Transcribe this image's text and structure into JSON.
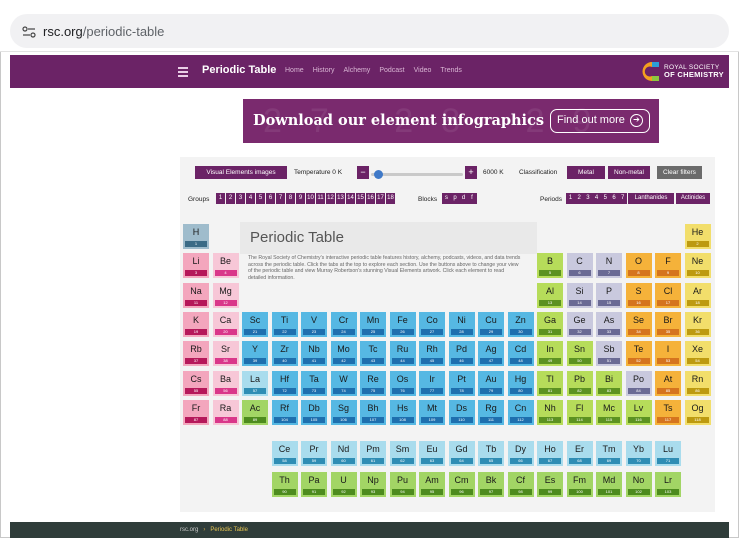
{
  "browser": {
    "url_domain": "rsc.org",
    "url_path": "/periodic-table"
  },
  "nav": {
    "title": "Periodic Table",
    "links": [
      "Home",
      "History",
      "Alchemy",
      "Podcast",
      "Video",
      "Trends"
    ],
    "logo_line1": "ROYAL SOCIETY",
    "logo_line2": "OF CHEMISTRY"
  },
  "banner": {
    "text": "Download our element infographics",
    "button": "Find out more",
    "bg_numbers": "27 28 29 30"
  },
  "controls": {
    "visual": "Visual Elements images",
    "temperature_label": "Temperature 0 K",
    "temp_value": "6000 K",
    "classification_label": "Classification",
    "metal": "Metal",
    "nonmetal": "Non-metal",
    "clear": "Clear filters",
    "groups_label": "Groups",
    "groups": [
      "1",
      "2",
      "3",
      "4",
      "5",
      "6",
      "7",
      "8",
      "9",
      "10",
      "11",
      "12",
      "13",
      "14",
      "15",
      "16",
      "17",
      "18"
    ],
    "blocks_label": "Blocks",
    "blocks": [
      "s",
      "p",
      "d",
      "f"
    ],
    "periods_label": "Periods",
    "periods": [
      "1",
      "2",
      "3",
      "4",
      "5",
      "6",
      "7"
    ],
    "lanthanides": "Lanthanides",
    "actinides": "Actinides"
  },
  "title": "Periodic Table",
  "description": "The Royal Society of Chemistry's interactive periodic table features history, alchemy, podcasts, videos, and data trends across the periodic table. Click the tabs at the top to explore each section. Use the buttons above to change your view of the periodic table and view Murray Robertson's stunning Visual Elements artwork. Click each element to read detailed information.",
  "colors": {
    "purple": "#6b2366",
    "alkali": "#f3a6bd",
    "alkali_num": "#b5185a",
    "alkaline": "#f7c7d7",
    "alkaline_num": "#d9378a",
    "transition": "#56b8e3",
    "transition_num": "#1e6fae",
    "post": "#b6dc5a",
    "post_num": "#5c9221",
    "metalloid": "#c9c9de",
    "metalloid_num": "#6a6a94",
    "nonmetal": "#f5b23a",
    "nonmetal_num": "#d5741e",
    "halogen": "#f4d24b",
    "halogen_num": "#c8940f",
    "noble": "#f2de6b",
    "noble_num": "#bd9a10",
    "hydrogen": "#9fbccc",
    "hydrogen_num": "#3b6b86",
    "lanth": "#a9dced",
    "lanth_num": "#2f8db4",
    "actin": "#a2d565",
    "actin_num": "#4d8b1e",
    "footer": "#2f3d3a"
  },
  "elements": [
    {
      "s": "H",
      "n": "1",
      "c": "hydrogen",
      "col": 1,
      "row": 1
    },
    {
      "s": "He",
      "n": "2",
      "c": "noble",
      "col": 18,
      "row": 1
    },
    {
      "s": "Li",
      "n": "3",
      "c": "alkali",
      "col": 1,
      "row": 2
    },
    {
      "s": "Be",
      "n": "4",
      "c": "alkaline",
      "col": 2,
      "row": 2
    },
    {
      "s": "B",
      "n": "5",
      "c": "post",
      "col": 13,
      "row": 2
    },
    {
      "s": "C",
      "n": "6",
      "c": "metalloid",
      "col": 14,
      "row": 2
    },
    {
      "s": "N",
      "n": "7",
      "c": "metalloid",
      "col": 15,
      "row": 2
    },
    {
      "s": "O",
      "n": "8",
      "c": "nonmetal",
      "col": 16,
      "row": 2
    },
    {
      "s": "F",
      "n": "9",
      "c": "nonmetal",
      "col": 17,
      "row": 2
    },
    {
      "s": "Ne",
      "n": "10",
      "c": "noble",
      "col": 18,
      "row": 2
    },
    {
      "s": "Na",
      "n": "11",
      "c": "alkali",
      "col": 1,
      "row": 3
    },
    {
      "s": "Mg",
      "n": "12",
      "c": "alkaline",
      "col": 2,
      "row": 3
    },
    {
      "s": "Al",
      "n": "13",
      "c": "post",
      "col": 13,
      "row": 3
    },
    {
      "s": "Si",
      "n": "14",
      "c": "metalloid",
      "col": 14,
      "row": 3
    },
    {
      "s": "P",
      "n": "15",
      "c": "metalloid",
      "col": 15,
      "row": 3
    },
    {
      "s": "S",
      "n": "16",
      "c": "nonmetal",
      "col": 16,
      "row": 3
    },
    {
      "s": "Cl",
      "n": "17",
      "c": "nonmetal",
      "col": 17,
      "row": 3
    },
    {
      "s": "Ar",
      "n": "18",
      "c": "noble",
      "col": 18,
      "row": 3
    },
    {
      "s": "K",
      "n": "19",
      "c": "alkali",
      "col": 1,
      "row": 4
    },
    {
      "s": "Ca",
      "n": "20",
      "c": "alkaline",
      "col": 2,
      "row": 4
    },
    {
      "s": "Sc",
      "n": "21",
      "c": "transition",
      "col": 3,
      "row": 4
    },
    {
      "s": "Ti",
      "n": "22",
      "c": "transition",
      "col": 4,
      "row": 4
    },
    {
      "s": "V",
      "n": "23",
      "c": "transition",
      "col": 5,
      "row": 4
    },
    {
      "s": "Cr",
      "n": "24",
      "c": "transition",
      "col": 6,
      "row": 4
    },
    {
      "s": "Mn",
      "n": "25",
      "c": "transition",
      "col": 7,
      "row": 4
    },
    {
      "s": "Fe",
      "n": "26",
      "c": "transition",
      "col": 8,
      "row": 4
    },
    {
      "s": "Co",
      "n": "27",
      "c": "transition",
      "col": 9,
      "row": 4
    },
    {
      "s": "Ni",
      "n": "28",
      "c": "transition",
      "col": 10,
      "row": 4
    },
    {
      "s": "Cu",
      "n": "29",
      "c": "transition",
      "col": 11,
      "row": 4
    },
    {
      "s": "Zn",
      "n": "30",
      "c": "transition",
      "col": 12,
      "row": 4
    },
    {
      "s": "Ga",
      "n": "31",
      "c": "post",
      "col": 13,
      "row": 4
    },
    {
      "s": "Ge",
      "n": "32",
      "c": "metalloid",
      "col": 14,
      "row": 4
    },
    {
      "s": "As",
      "n": "33",
      "c": "metalloid",
      "col": 15,
      "row": 4
    },
    {
      "s": "Se",
      "n": "34",
      "c": "nonmetal",
      "col": 16,
      "row": 4
    },
    {
      "s": "Br",
      "n": "35",
      "c": "nonmetal",
      "col": 17,
      "row": 4
    },
    {
      "s": "Kr",
      "n": "36",
      "c": "noble",
      "col": 18,
      "row": 4
    },
    {
      "s": "Rb",
      "n": "37",
      "c": "alkali",
      "col": 1,
      "row": 5
    },
    {
      "s": "Sr",
      "n": "38",
      "c": "alkaline",
      "col": 2,
      "row": 5
    },
    {
      "s": "Y",
      "n": "39",
      "c": "transition",
      "col": 3,
      "row": 5
    },
    {
      "s": "Zr",
      "n": "40",
      "c": "transition",
      "col": 4,
      "row": 5
    },
    {
      "s": "Nb",
      "n": "41",
      "c": "transition",
      "col": 5,
      "row": 5
    },
    {
      "s": "Mo",
      "n": "42",
      "c": "transition",
      "col": 6,
      "row": 5
    },
    {
      "s": "Tc",
      "n": "43",
      "c": "transition",
      "col": 7,
      "row": 5
    },
    {
      "s": "Ru",
      "n": "44",
      "c": "transition",
      "col": 8,
      "row": 5
    },
    {
      "s": "Rh",
      "n": "45",
      "c": "transition",
      "col": 9,
      "row": 5
    },
    {
      "s": "Pd",
      "n": "46",
      "c": "transition",
      "col": 10,
      "row": 5
    },
    {
      "s": "Ag",
      "n": "47",
      "c": "transition",
      "col": 11,
      "row": 5
    },
    {
      "s": "Cd",
      "n": "48",
      "c": "transition",
      "col": 12,
      "row": 5
    },
    {
      "s": "In",
      "n": "49",
      "c": "post",
      "col": 13,
      "row": 5
    },
    {
      "s": "Sn",
      "n": "50",
      "c": "post",
      "col": 14,
      "row": 5
    },
    {
      "s": "Sb",
      "n": "51",
      "c": "metalloid",
      "col": 15,
      "row": 5
    },
    {
      "s": "Te",
      "n": "52",
      "c": "nonmetal",
      "col": 16,
      "row": 5
    },
    {
      "s": "I",
      "n": "53",
      "c": "nonmetal",
      "col": 17,
      "row": 5
    },
    {
      "s": "Xe",
      "n": "54",
      "c": "noble",
      "col": 18,
      "row": 5
    },
    {
      "s": "Cs",
      "n": "55",
      "c": "alkali",
      "col": 1,
      "row": 6
    },
    {
      "s": "Ba",
      "n": "56",
      "c": "alkaline",
      "col": 2,
      "row": 6
    },
    {
      "s": "La",
      "n": "57",
      "c": "lanth",
      "col": 3,
      "row": 6
    },
    {
      "s": "Hf",
      "n": "72",
      "c": "transition",
      "col": 4,
      "row": 6
    },
    {
      "s": "Ta",
      "n": "73",
      "c": "transition",
      "col": 5,
      "row": 6
    },
    {
      "s": "W",
      "n": "74",
      "c": "transition",
      "col": 6,
      "row": 6
    },
    {
      "s": "Re",
      "n": "75",
      "c": "transition",
      "col": 7,
      "row": 6
    },
    {
      "s": "Os",
      "n": "76",
      "c": "transition",
      "col": 8,
      "row": 6
    },
    {
      "s": "Ir",
      "n": "77",
      "c": "transition",
      "col": 9,
      "row": 6
    },
    {
      "s": "Pt",
      "n": "78",
      "c": "transition",
      "col": 10,
      "row": 6
    },
    {
      "s": "Au",
      "n": "79",
      "c": "transition",
      "col": 11,
      "row": 6
    },
    {
      "s": "Hg",
      "n": "80",
      "c": "transition",
      "col": 12,
      "row": 6
    },
    {
      "s": "Tl",
      "n": "81",
      "c": "post",
      "col": 13,
      "row": 6
    },
    {
      "s": "Pb",
      "n": "82",
      "c": "post",
      "col": 14,
      "row": 6
    },
    {
      "s": "Bi",
      "n": "83",
      "c": "post",
      "col": 15,
      "row": 6
    },
    {
      "s": "Po",
      "n": "84",
      "c": "metalloid",
      "col": 16,
      "row": 6
    },
    {
      "s": "At",
      "n": "85",
      "c": "nonmetal",
      "col": 17,
      "row": 6
    },
    {
      "s": "Rn",
      "n": "86",
      "c": "noble",
      "col": 18,
      "row": 6
    },
    {
      "s": "Fr",
      "n": "87",
      "c": "alkali",
      "col": 1,
      "row": 7
    },
    {
      "s": "Ra",
      "n": "88",
      "c": "alkaline",
      "col": 2,
      "row": 7
    },
    {
      "s": "Ac",
      "n": "89",
      "c": "actin",
      "col": 3,
      "row": 7
    },
    {
      "s": "Rf",
      "n": "104",
      "c": "transition",
      "col": 4,
      "row": 7
    },
    {
      "s": "Db",
      "n": "105",
      "c": "transition",
      "col": 5,
      "row": 7
    },
    {
      "s": "Sg",
      "n": "106",
      "c": "transition",
      "col": 6,
      "row": 7
    },
    {
      "s": "Bh",
      "n": "107",
      "c": "transition",
      "col": 7,
      "row": 7
    },
    {
      "s": "Hs",
      "n": "108",
      "c": "transition",
      "col": 8,
      "row": 7
    },
    {
      "s": "Mt",
      "n": "109",
      "c": "transition",
      "col": 9,
      "row": 7
    },
    {
      "s": "Ds",
      "n": "110",
      "c": "transition",
      "col": 10,
      "row": 7
    },
    {
      "s": "Rg",
      "n": "111",
      "c": "transition",
      "col": 11,
      "row": 7
    },
    {
      "s": "Cn",
      "n": "112",
      "c": "transition",
      "col": 12,
      "row": 7
    },
    {
      "s": "Nh",
      "n": "113",
      "c": "post",
      "col": 13,
      "row": 7
    },
    {
      "s": "Fl",
      "n": "114",
      "c": "post",
      "col": 14,
      "row": 7
    },
    {
      "s": "Mc",
      "n": "115",
      "c": "post",
      "col": 15,
      "row": 7
    },
    {
      "s": "Lv",
      "n": "116",
      "c": "post",
      "col": 16,
      "row": 7
    },
    {
      "s": "Ts",
      "n": "117",
      "c": "nonmetal",
      "col": 17,
      "row": 7
    },
    {
      "s": "Og",
      "n": "118",
      "c": "noble",
      "col": 18,
      "row": 7
    },
    {
      "s": "Ce",
      "n": "58",
      "c": "lanth",
      "col": 4,
      "row": 9
    },
    {
      "s": "Pr",
      "n": "59",
      "c": "lanth",
      "col": 5,
      "row": 9
    },
    {
      "s": "Nd",
      "n": "60",
      "c": "lanth",
      "col": 6,
      "row": 9
    },
    {
      "s": "Pm",
      "n": "61",
      "c": "lanth",
      "col": 7,
      "row": 9
    },
    {
      "s": "Sm",
      "n": "62",
      "c": "lanth",
      "col": 8,
      "row": 9
    },
    {
      "s": "Eu",
      "n": "63",
      "c": "lanth",
      "col": 9,
      "row": 9
    },
    {
      "s": "Gd",
      "n": "64",
      "c": "lanth",
      "col": 10,
      "row": 9
    },
    {
      "s": "Tb",
      "n": "65",
      "c": "lanth",
      "col": 11,
      "row": 9
    },
    {
      "s": "Dy",
      "n": "66",
      "c": "lanth",
      "col": 12,
      "row": 9
    },
    {
      "s": "Ho",
      "n": "67",
      "c": "lanth",
      "col": 13,
      "row": 9
    },
    {
      "s": "Er",
      "n": "68",
      "c": "lanth",
      "col": 14,
      "row": 9
    },
    {
      "s": "Tm",
      "n": "69",
      "c": "lanth",
      "col": 15,
      "row": 9
    },
    {
      "s": "Yb",
      "n": "70",
      "c": "lanth",
      "col": 16,
      "row": 9
    },
    {
      "s": "Lu",
      "n": "71",
      "c": "lanth",
      "col": 17,
      "row": 9
    },
    {
      "s": "Th",
      "n": "90",
      "c": "actin",
      "col": 4,
      "row": 10
    },
    {
      "s": "Pa",
      "n": "91",
      "c": "actin",
      "col": 5,
      "row": 10
    },
    {
      "s": "U",
      "n": "92",
      "c": "actin",
      "col": 6,
      "row": 10
    },
    {
      "s": "Np",
      "n": "93",
      "c": "actin",
      "col": 7,
      "row": 10
    },
    {
      "s": "Pu",
      "n": "94",
      "c": "actin",
      "col": 8,
      "row": 10
    },
    {
      "s": "Am",
      "n": "95",
      "c": "actin",
      "col": 9,
      "row": 10
    },
    {
      "s": "Cm",
      "n": "96",
      "c": "actin",
      "col": 10,
      "row": 10
    },
    {
      "s": "Bk",
      "n": "97",
      "c": "actin",
      "col": 11,
      "row": 10
    },
    {
      "s": "Cf",
      "n": "98",
      "c": "actin",
      "col": 12,
      "row": 10
    },
    {
      "s": "Es",
      "n": "99",
      "c": "actin",
      "col": 13,
      "row": 10
    },
    {
      "s": "Fm",
      "n": "100",
      "c": "actin",
      "col": 14,
      "row": 10
    },
    {
      "s": "Md",
      "n": "101",
      "c": "actin",
      "col": 15,
      "row": 10
    },
    {
      "s": "No",
      "n": "102",
      "c": "actin",
      "col": 16,
      "row": 10
    },
    {
      "s": "Lr",
      "n": "103",
      "c": "actin",
      "col": 17,
      "row": 10
    }
  ],
  "footer": {
    "crumb1": "rsc.org",
    "sep": "›",
    "crumb2": "Periodic Table"
  }
}
